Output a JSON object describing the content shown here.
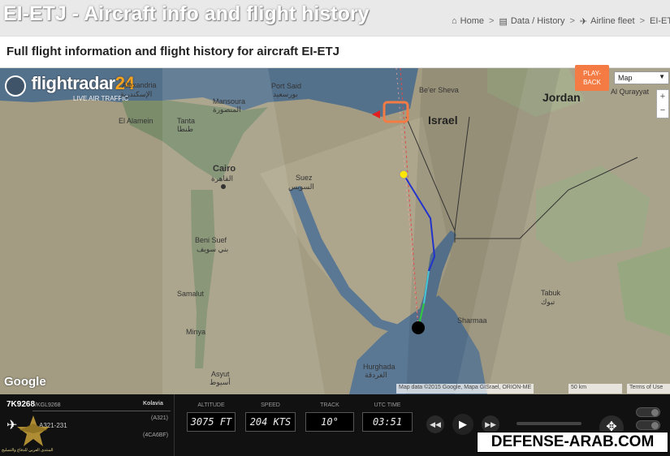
{
  "page": {
    "title": "EI-ETJ - Aircraft info and flight history",
    "subtitle": "Full flight information and flight history for aircraft EI-ETJ"
  },
  "breadcrumb": {
    "home": "Home",
    "data_history": "Data / History",
    "airline_fleet": "Airline fleet",
    "current": "EI-ET"
  },
  "map": {
    "logo_text": "flightradar",
    "logo_num": "24",
    "logo_tag": "LIVE AIR TRAFFIC",
    "playback_label": "PLAY-BACK",
    "map_type": "Map",
    "zoom_in": "+",
    "zoom_out": "−",
    "google_logo": "Google",
    "attribution": "Map data ©2015 Google, Mapa GISrael, ORION-ME",
    "scale": "50 km",
    "terms": "Terms of Use",
    "labels": {
      "israel": "Israel",
      "jordan": "Jordan",
      "alexandria": "Alexandria",
      "alexandria_ar": "الإسكندرية",
      "port_said": "Port Said",
      "port_said_ar": "بورسعيد",
      "mansoura": "Mansoura",
      "mansoura_ar": "المنصورة",
      "tanta": "Tanta",
      "tanta_ar": "طنطا",
      "cairo": "Cairo",
      "cairo_ar": "القاهرة",
      "suez": "Suez",
      "suez_ar": "السويس",
      "beni_suef": "Beni Suef",
      "beni_suef_ar": "بني سويف",
      "samalut": "Samalut",
      "minya": "Minya",
      "asyut": "Asyut",
      "asyut_ar": "أسيوط",
      "hurghada": "Hurghada",
      "hurghada_ar": "الغردقة",
      "tabuk": "Tabuk",
      "tabuk_ar": "تبوك",
      "beersheva": "Be'er Sheva",
      "quraiyat": "Al Qurayyat",
      "el_alamein": "El Alamein",
      "sharmaa": "Sharmaa"
    }
  },
  "flight": {
    "callsign": "7K9268",
    "callsign_alt": "/KGL9268",
    "airline": "Kolavia",
    "aircraft_type_full": "A321-231",
    "aircraft_type": "(A321)",
    "hex": "(4CA6BF)"
  },
  "readouts": {
    "altitude_label": "ALTITUDE",
    "altitude_value": "3075 FT",
    "speed_label": "SPEED",
    "speed_value": "204 KTS",
    "track_label": "TRACK",
    "track_value": "10°",
    "utc_label": "UTC TIME",
    "utc_value": "03:51"
  },
  "watermark": {
    "text": "DEFENSE-ARAB.COM"
  },
  "colors": {
    "playback": "#f47b44",
    "track_blue": "#2233cc",
    "track_cyan": "#44c8d8",
    "track_green": "#2ecc40"
  }
}
